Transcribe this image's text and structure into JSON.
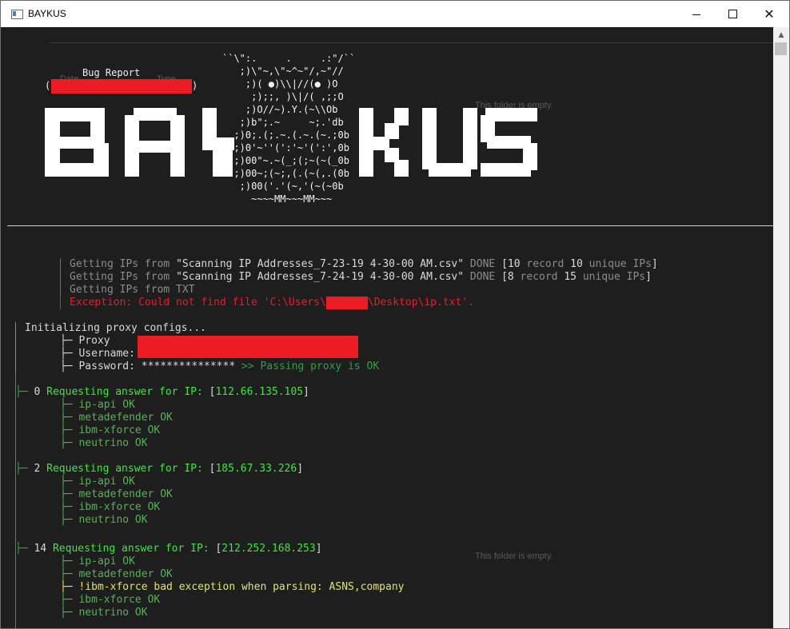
{
  "window": {
    "title": "BAYKUS"
  },
  "icons": {
    "app": "terminal-window-icon",
    "minimize": "minimize-icon",
    "maximize": "maximize-icon",
    "close": "close-icon",
    "scroll_up": "chevron-up-icon"
  },
  "colors": {
    "background": "#1e1e1e",
    "red": "#e81c2c",
    "green": "#2ea043",
    "bright_green": "#3ee63e",
    "yellow": "#e1e36b",
    "gray": "#8c8c8c",
    "mask": "#ed1c24"
  },
  "ghost": {
    "folder_empty_1": "This folder is empty.",
    "folder_empty_2": "This folder is empty.",
    "date_fragment": "Date",
    "type_fragment": "Type"
  },
  "banner": {
    "logo_text": "BAYKUS",
    "bug_report": "Bug Report",
    "open_paren": "(",
    "close_paren": ")",
    "owl_art": "``\\\":.     .     .:\"/``\n   ;)\\\"~,\\\"~^~\"/,~\"//\n    ;)( ●)\\\\|//(● )O\n     ;);;, )\\|/( ,;;O\n    ;)O//~).Y.(~\\\\Ob\n   ;)b\";.~     ~;.'db\n  ;)0;.(;.~.(.~.(~.;0b\n  ;)0'~''(':'~'(':',0b\n  ;)00\"~.~(_;(;~(~(_0b\n  ;)00~;(~;,(.(~(,.(0b\n   ;)00('.'(~,'(~(~0b\n     ~~~~MM~~~MM~~~"
  },
  "log": [
    {
      "text": "Getting IPs from \"Scanning IP Addresses_7-23-19 4-30-00 AM.csv\" DONE [10 record 10 unique IPs]"
    },
    {
      "text": "Getting IPs from \"Scanning IP Addresses_7-24-19 4-30-00 AM.csv\" DONE [8 record 15 unique IPs]"
    },
    {
      "text": "Getting IPs from TXT"
    },
    {
      "prefix": "Exception: Could not find file 'C:\\Users\\",
      "suffix": "\\Desktop\\ip.txt'."
    }
  ],
  "proxy": {
    "title": "Initializing proxy configs...",
    "proxy_label": "├─ Proxy    :",
    "username_label": "├─ Username:",
    "password_label": "├─ Password:",
    "password_value": "***************",
    "status": ">> Passing proxy is OK"
  },
  "requests": [
    {
      "idx": "0",
      "label": "Requesting answer for IP:",
      "ip": "112.66.135.105",
      "lines": [
        "├─ ip-api OK",
        "├─ metadefender OK",
        "├─ ibm-xforce OK",
        "├─ neutrino OK"
      ]
    },
    {
      "idx": "2",
      "label": "Requesting answer for IP:",
      "ip": "185.67.33.226",
      "lines": [
        "├─ ip-api OK",
        "├─ metadefender OK",
        "├─ ibm-xforce OK",
        "├─ neutrino OK"
      ]
    },
    {
      "idx": "14",
      "label": "Requesting answer for IP:",
      "ip": "212.252.168.253",
      "lines": [
        "├─ ip-api OK",
        "├─ metadefender OK",
        "├─ !ibm-xforce bad exception when parsing: ASNS,company",
        "├─ ibm-xforce OK",
        "├─ neutrino OK"
      ]
    }
  ],
  "tree": {
    "branch": "├─",
    "bracket_open": "[",
    "bracket_close": "]"
  }
}
